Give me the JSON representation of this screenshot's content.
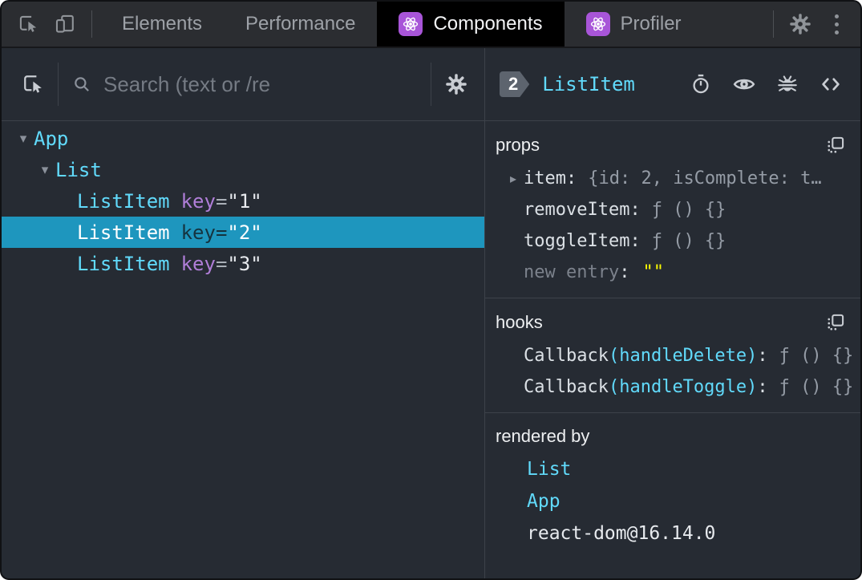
{
  "punct": {
    "colon": ":",
    "eq": "="
  },
  "topbar": {
    "tabs": [
      {
        "label": "Elements"
      },
      {
        "label": "Performance"
      },
      {
        "label": "Components"
      },
      {
        "label": "Profiler"
      }
    ]
  },
  "left": {
    "search_placeholder": "Search (text or /re",
    "tree": [
      {
        "name": "App"
      },
      {
        "name": "List"
      },
      {
        "name": "ListItem",
        "attr": "key",
        "value": "\"1\""
      },
      {
        "name": "ListItem",
        "attr": "key",
        "value": "\"2\""
      },
      {
        "name": "ListItem",
        "attr": "key",
        "value": "\"3\""
      }
    ]
  },
  "right": {
    "header": {
      "badge": "2",
      "title": "ListItem"
    },
    "props": {
      "title": "props",
      "rows": [
        {
          "name": "item",
          "value": "{id: 2, isComplete: t…"
        },
        {
          "name": "removeItem",
          "value": "ƒ () {}"
        },
        {
          "name": "toggleItem",
          "value": "ƒ () {}"
        }
      ],
      "new_entry": {
        "name": "new entry",
        "value": "\"\""
      }
    },
    "hooks": {
      "title": "hooks",
      "rows": [
        {
          "fn": "Callback",
          "arg": "(handleDelete)",
          "value": "ƒ () {}"
        },
        {
          "fn": "Callback",
          "arg": "(handleToggle)",
          "value": "ƒ () {}"
        }
      ]
    },
    "rendered_by": {
      "title": "rendered by",
      "rows": [
        {
          "label": "List"
        },
        {
          "label": "App"
        },
        {
          "label": "react-dom@16.14.0"
        }
      ]
    }
  },
  "colors": {
    "accent_cyan": "#61dafb",
    "key_purple": "#b07ed8",
    "selected_blue": "#1e96be",
    "react_purple": "#a855d8",
    "new_entry_yellow": "#ffff00",
    "panel_bg": "#262b33"
  }
}
